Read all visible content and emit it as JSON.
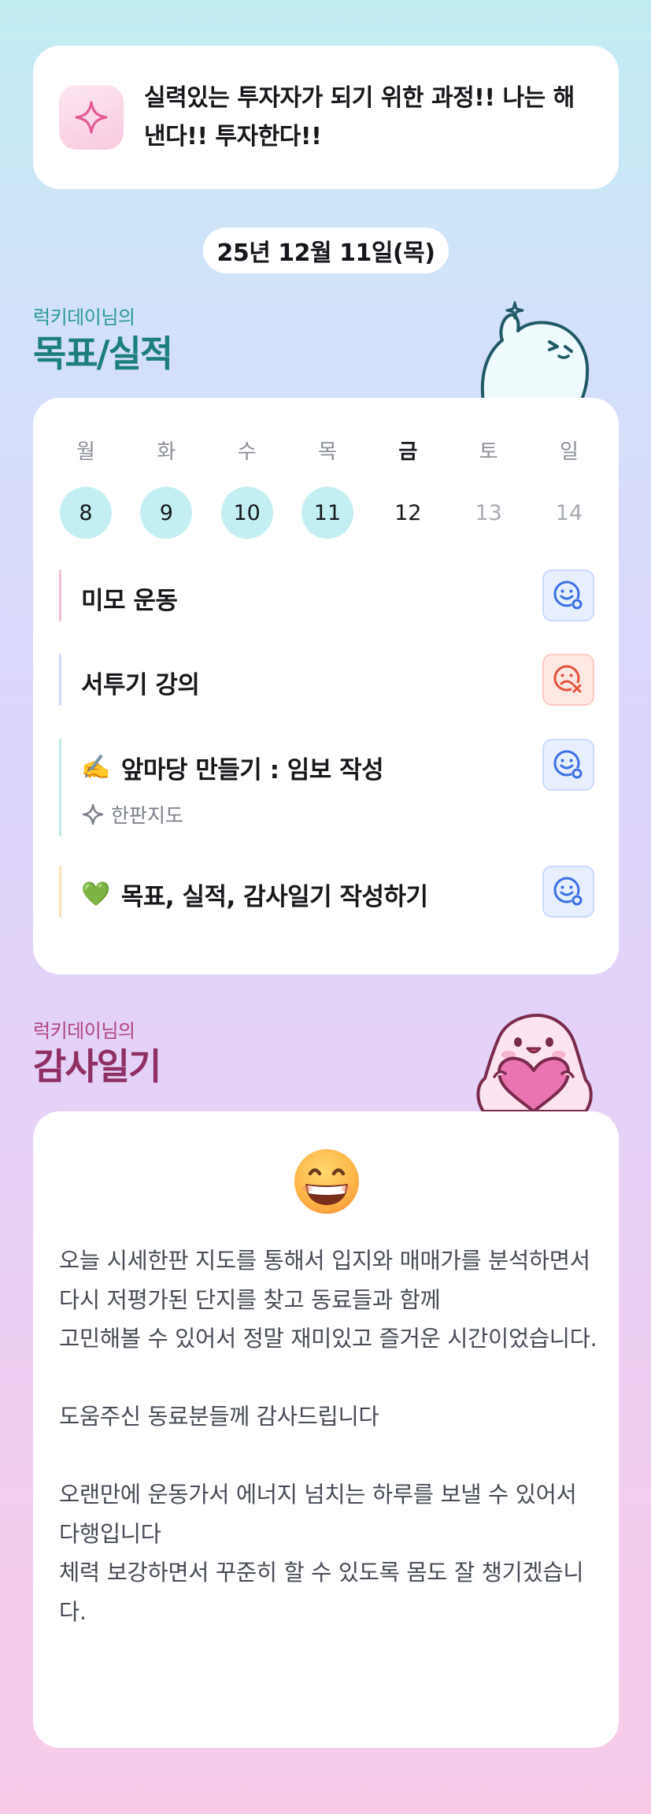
{
  "motto": {
    "icon": "sparkle-icon",
    "text": "실력있는 투자자가 되기 위한 과정!! 나는 해낸다!! 투자한다!!"
  },
  "date_label": "25년 12월 11일(목)",
  "goals_section": {
    "subtitle": "럭키데이님의",
    "title": "목표/실적"
  },
  "week": {
    "days": [
      {
        "weekday": "월",
        "date": "8",
        "state": "done"
      },
      {
        "weekday": "화",
        "date": "9",
        "state": "done"
      },
      {
        "weekday": "수",
        "date": "10",
        "state": "done"
      },
      {
        "weekday": "목",
        "date": "11",
        "state": "done"
      },
      {
        "weekday": "금",
        "date": "12",
        "state": "today"
      },
      {
        "weekday": "토",
        "date": "13",
        "state": "future"
      },
      {
        "weekday": "일",
        "date": "14",
        "state": "future"
      }
    ]
  },
  "goals": [
    {
      "label": "미모 운동",
      "emoji": "",
      "bar_color": "#f4bcd6",
      "status": "achieved",
      "status_icon": "smile-check-icon"
    },
    {
      "label": "서투기 강의",
      "emoji": "",
      "bar_color": "#cfdcf8",
      "status": "missed",
      "status_icon": "sad-x-icon"
    },
    {
      "label": "앞마당 만들기 : 임보 작성",
      "emoji": "✍️",
      "bar_color": "#bdebe7",
      "status": "achieved",
      "status_icon": "smile-check-icon",
      "sub_label": "한판지도",
      "sub_icon": "sparkle-outline-icon"
    },
    {
      "label": "목표, 실적, 감사일기 작성하기",
      "emoji": "💚",
      "bar_color": "#fbe3b5",
      "status": "achieved",
      "status_icon": "smile-check-icon"
    }
  ],
  "thanks_section": {
    "subtitle": "럭키데이님의",
    "title": "감사일기"
  },
  "diary": {
    "mood_icon": "grinning-face-icon",
    "text": "오늘 시세한판 지도를 통해서 입지와 매매가를 분석하면서\n다시 저평가된 단지를 찾고 동료들과 함께\n고민해볼 수 있어서 정말 재미있고 즐거운 시간이었습니다.\n\n도움주신 동료분들께 감사드립니다\n\n오랜만에 운동가서 에너지 넘치는 하루를 보낼 수 있어서 다행입니다\n체력 보강하면서 꾸준히 할 수 있도록 몸도 잘 챙기겠습니다."
  },
  "colors": {
    "goal_accent": "#1d7f7b",
    "thanks_accent": "#8f2f63",
    "done_day": "#c3eff3",
    "achieved": "#3b6fe6",
    "missed": "#e5533d"
  }
}
